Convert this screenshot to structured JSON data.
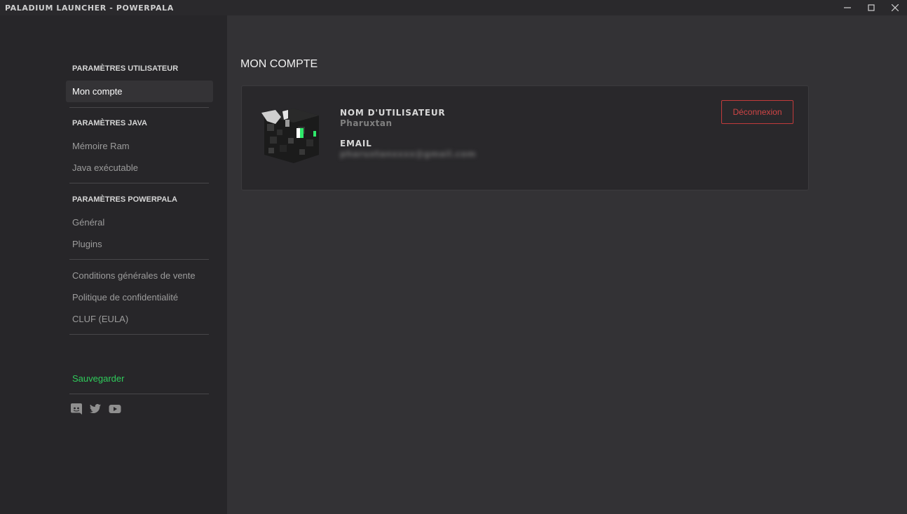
{
  "window": {
    "title": "PALADIUM LAUNCHER - POWERPALA",
    "minimize_icon": "minimize-icon",
    "maximize_icon": "maximize-icon",
    "close_icon": "close-icon"
  },
  "sidebar": {
    "sections": [
      {
        "title": "PARAMÈTRES UTILISATEUR",
        "items": [
          "Mon compte"
        ]
      },
      {
        "title": "PARAMÈTRES JAVA",
        "items": [
          "Mémoire Ram",
          "Java exécutable"
        ]
      },
      {
        "title": "PARAMÈTRES POWERPALA",
        "items": [
          "Général",
          "Plugins"
        ]
      },
      {
        "title": "",
        "items": [
          "Conditions générales de vente",
          "Politique de confidentialité",
          "CLUF (EULA)"
        ]
      }
    ],
    "active_item": "Mon compte",
    "save_label": "Sauvegarder",
    "social_icons": [
      "discord-icon",
      "twitter-icon",
      "youtube-icon"
    ]
  },
  "main": {
    "title": "MON COMPTE",
    "account": {
      "username_label": "NOM D'UTILISATEUR",
      "username": "Pharuxtan",
      "email_label": "EMAIL",
      "email": "pharuxtanxxxx@gmail.com",
      "logout_label": "Déconnexion"
    }
  },
  "colors": {
    "accent_green": "#2fcc5b",
    "danger_red": "#d04545",
    "sidebar_bg": "#272629",
    "main_bg": "#333235"
  }
}
